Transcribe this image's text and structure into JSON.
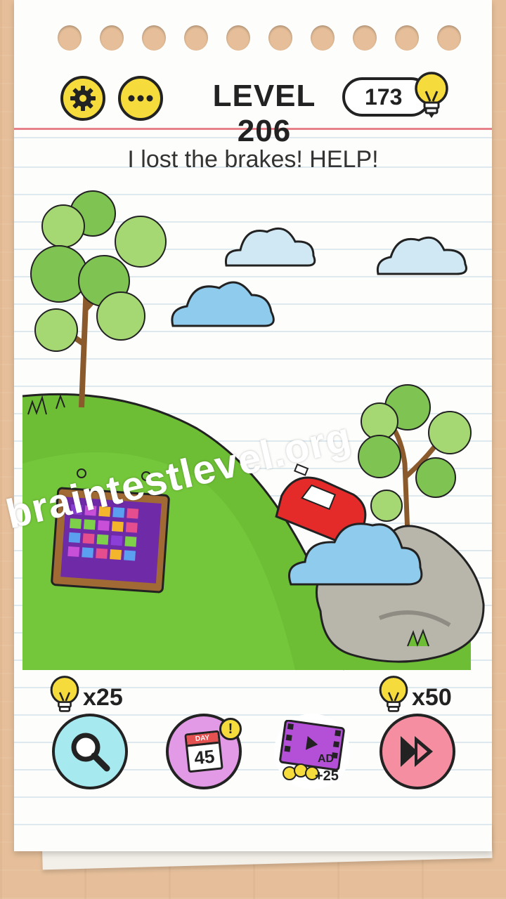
{
  "header": {
    "level_label": "LEVEL 206",
    "hint_count": "173",
    "settings_icon": "gear-icon",
    "menu_icon": "more-dots-icon",
    "hint_icon": "lightbulb-icon"
  },
  "puzzle": {
    "question": "I lost the brakes! HELP!"
  },
  "scene": {
    "items": [
      "tree",
      "cloud",
      "cloud",
      "cloud",
      "hill",
      "game-ad-board",
      "red-car",
      "cloud-cover",
      "rock",
      "tree"
    ]
  },
  "watermark": "braintestlevel.org",
  "tools": {
    "search_cost": "x25",
    "calendar_day_label": "DAY",
    "calendar_day": "45",
    "calendar_alert": "!",
    "ad_label": "AD",
    "ad_reward": "+25",
    "skip_cost": "x50"
  },
  "colors": {
    "hint_yellow": "#f5dc3c",
    "grass": "#6dbe35",
    "cloud": "#9fd6ee",
    "car": "#e52a2a",
    "search_bg": "#a6e9ef",
    "calendar_bg": "#e39ae6",
    "skip_bg": "#f48ea0"
  }
}
